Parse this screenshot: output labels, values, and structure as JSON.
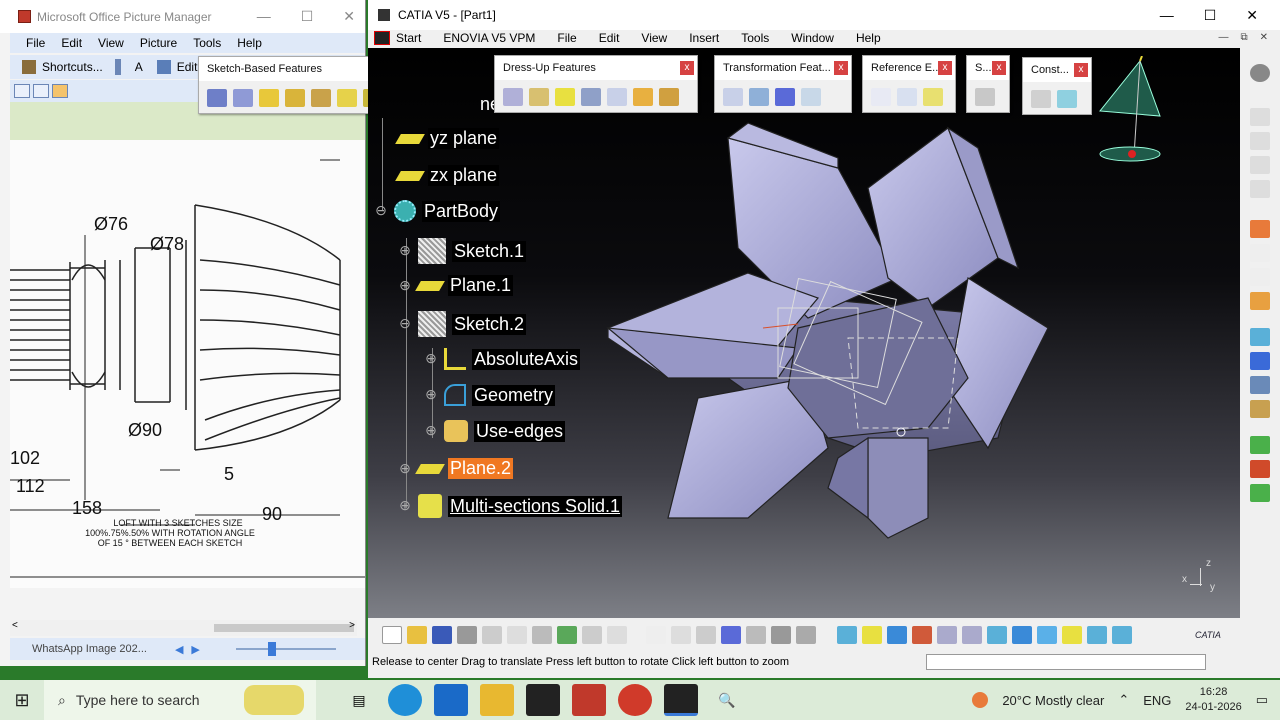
{
  "picture_manager": {
    "title": "Microsoft Office Picture Manager",
    "menu": [
      "File",
      "Edit",
      "View",
      "Picture",
      "Tools",
      "Help"
    ],
    "toolbar_shortcuts": "Shortcuts...",
    "toolbar_edit": "Edit P",
    "status_filename": "WhatsApp Image 202...",
    "drawing": {
      "dims": [
        "Ø76",
        "Ø78",
        "Ø90",
        "102",
        "112",
        "158",
        "5",
        "90"
      ],
      "note_line1": "LOFT WITH 3 SKETCHES SIZE",
      "note_line2": "100%.75%.50% WITH ROTATION ANGLE",
      "note_line3": "OF 15 ° BETWEEN EACH SKETCH"
    }
  },
  "sketch_toolbar": {
    "title": "Sketch-Based Features",
    "close": "x"
  },
  "catia": {
    "title": "CATIA V5 - [Part1]",
    "menu": [
      "Start",
      "ENOVIA V5 VPM",
      "File",
      "Edit",
      "View",
      "Insert",
      "Tools",
      "Window",
      "Help"
    ],
    "toolbars": [
      {
        "title": "Dress-Up Features",
        "close": "x"
      },
      {
        "title": "Transformation Feat...",
        "close": "x"
      },
      {
        "title": "Reference E...",
        "close": "x"
      },
      {
        "title": "S...",
        "close": "x"
      },
      {
        "title": "Const...",
        "close": "x"
      }
    ],
    "tree_partial": "ne",
    "tree": [
      {
        "label": "yz plane"
      },
      {
        "label": "zx plane"
      },
      {
        "label": "PartBody"
      },
      {
        "label": "Sketch.1"
      },
      {
        "label": "Plane.1"
      },
      {
        "label": "Sketch.2"
      },
      {
        "label": "AbsoluteAxis"
      },
      {
        "label": "Geometry"
      },
      {
        "label": "Use-edges"
      },
      {
        "label": "Plane.2"
      },
      {
        "label": "Multi-sections Solid.1"
      }
    ],
    "status": "Release to center  Drag to translate  Press left button to rotate  Click left button to zoom",
    "brand": "CATIA",
    "axis": {
      "x": "x",
      "y": "y",
      "z": "z"
    },
    "colors": {
      "solid": "#a9a9d4",
      "selected": "#f07822"
    }
  },
  "taskbar": {
    "search_placeholder": "Type here to search",
    "weather": "20°C  Mostly clear",
    "lang": "ENG",
    "time": "16:28",
    "date": "24-01-2026"
  }
}
